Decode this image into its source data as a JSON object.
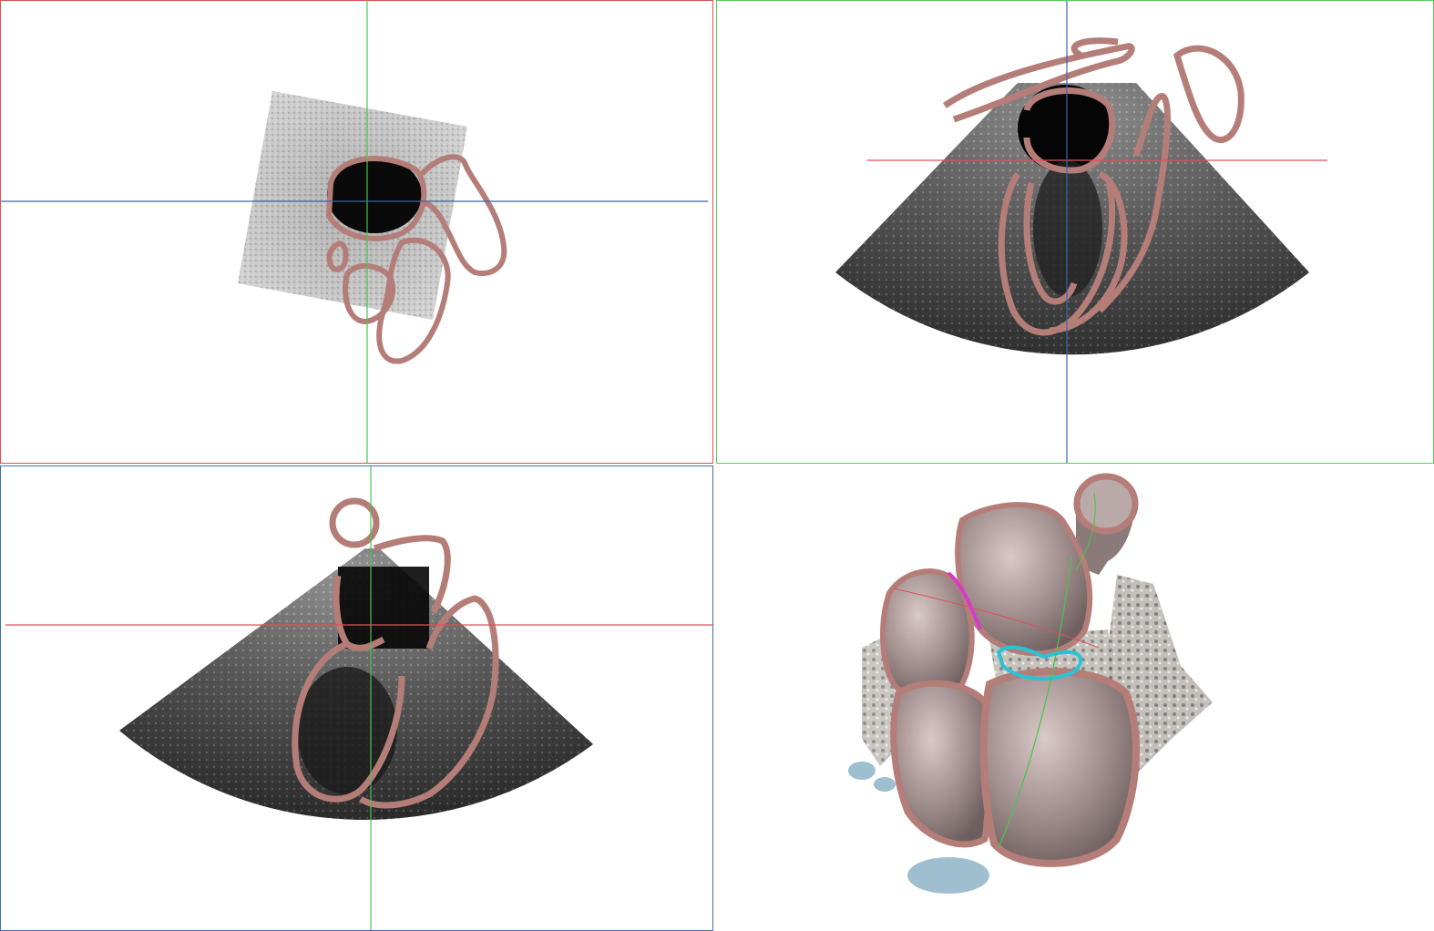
{
  "layout_title": "",
  "colors": {
    "axial_frame": "#d9534f",
    "sagittal_frame": "#5cc85c",
    "coronal_frame": "#3f6fa8",
    "contour": "#b47d78",
    "mitral_annulus": "#29c3d6",
    "tricuspid_marker": "#d63ac9",
    "crosshair_red": "#e0505a",
    "crosshair_green": "#4cc44c",
    "crosshair_blue": "#3a64b0"
  },
  "viewports": [
    {
      "id": "axial",
      "label": "",
      "icon": "ultrasound-slice-icon"
    },
    {
      "id": "sagittal",
      "label": "",
      "icon": "ultrasound-sector-icon"
    },
    {
      "id": "coronal",
      "label": "",
      "icon": "ultrasound-sector-icon"
    },
    {
      "id": "render3d",
      "label": "",
      "icon": "heart-3d-model-icon"
    }
  ]
}
